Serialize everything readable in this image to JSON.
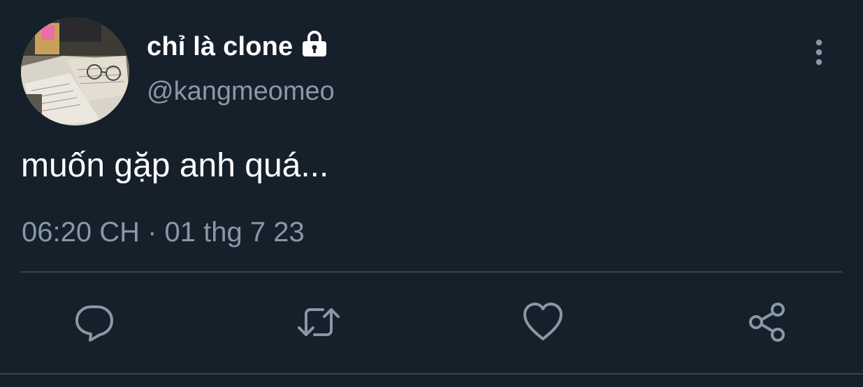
{
  "author": {
    "display_name": "chỉ là clone",
    "handle": "@kangmeomeo",
    "protected_icon": "lock-icon",
    "avatar": "avatar-photo-open-books-glasses"
  },
  "tweet": {
    "text": "muốn gặp anh quá...",
    "timestamp": "06:20 CH · 01 thg 7 23"
  },
  "menu": {
    "icon": "more-vertical-icon"
  },
  "actions": [
    {
      "name": "reply",
      "icon": "reply-icon"
    },
    {
      "name": "retweet",
      "icon": "retweet-icon"
    },
    {
      "name": "like",
      "icon": "heart-icon"
    },
    {
      "name": "share",
      "icon": "share-icon"
    }
  ],
  "colors": {
    "background": "#15202b",
    "primary_text": "#ffffff",
    "secondary_text": "#8899a6",
    "divider": "#38444d"
  }
}
